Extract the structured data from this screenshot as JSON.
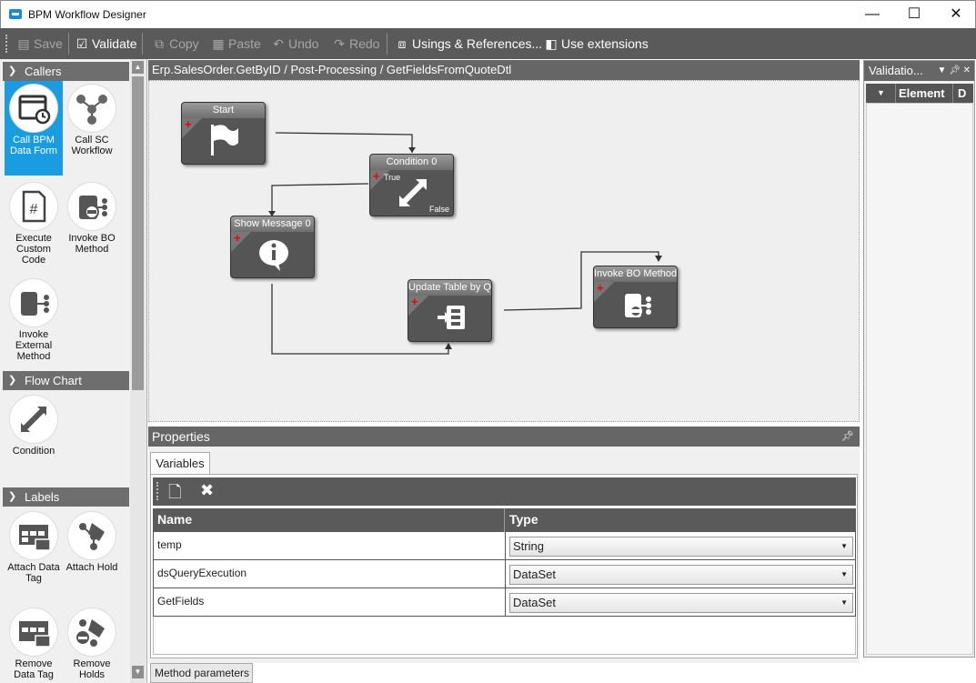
{
  "window": {
    "title": "BPM Workflow Designer",
    "minimize": "—",
    "maximize": "☐",
    "close": "✕"
  },
  "toolbar": {
    "save": "Save",
    "validate": "Validate",
    "copy": "Copy",
    "paste": "Paste",
    "undo": "Undo",
    "redo": "Redo",
    "usings": "Usings & References...",
    "extensions": "Use extensions"
  },
  "toolbox": {
    "callers_header": "Callers",
    "flowchart_header": "Flow Chart",
    "labels_header": "Labels",
    "items": {
      "call_bpm": "Call BPM Data Form",
      "call_sc": "Call SC Workflow",
      "execute_code": "Execute Custom Code",
      "invoke_bo": "Invoke BO Method",
      "invoke_external": "Invoke External Method",
      "condition": "Condition",
      "attach_data_tag": "Attach Data Tag",
      "attach_hold": "Attach Hold",
      "remove_data_tag": "Remove Data Tag",
      "remove_holds": "Remove Holds"
    }
  },
  "breadcrumb": "Erp.SalesOrder.GetByID / Post-Processing / GetFieldsFromQuoteDtl",
  "nodes": {
    "start": "Start",
    "condition": "Condition 0",
    "condition_true": "True",
    "condition_false": "False",
    "show_message": "Show Message 0",
    "update_table": "Update Table by Q",
    "invoke_bo": "Invoke BO Method"
  },
  "properties": {
    "title": "Properties",
    "tab": "Variables",
    "columns": {
      "name": "Name",
      "type": "Type"
    },
    "rows": [
      {
        "name": "temp",
        "type": "String"
      },
      {
        "name": "dsQueryExecution",
        "type": "DataSet"
      },
      {
        "name": "GetFields",
        "type": "DataSet"
      }
    ]
  },
  "bottom_tab": "Method parameters",
  "validation": {
    "title": "Validatio...",
    "col_element": "Element",
    "col_d": "D"
  },
  "colors": {
    "selected_tool": "#1a9ce0",
    "toolbar_bg": "#5a5a5a",
    "header_bg": "#666666",
    "node_plus": "#e00000"
  }
}
